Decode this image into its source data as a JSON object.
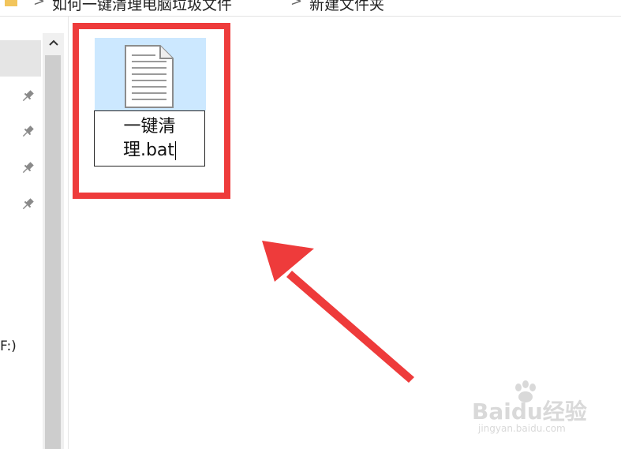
{
  "address_bar": {
    "crumbs": [
      "如何一键清理电脑垃圾文件",
      "新建文件夹"
    ],
    "separator": ">"
  },
  "nav_pane": {
    "drive_label": "F:)",
    "pinned_count_visible": 4
  },
  "scrollbar": {
    "up_arrow": "^"
  },
  "file": {
    "name_line1": "一键清",
    "name_line2": "理.bat",
    "icon": "text-file-icon",
    "state": "renaming"
  },
  "annotation": {
    "highlight_color": "#ee3b3b",
    "arrow_color": "#ee3b3b"
  },
  "watermark": {
    "brand": "Baidu经验",
    "url": "jingyan.baidu.com"
  }
}
